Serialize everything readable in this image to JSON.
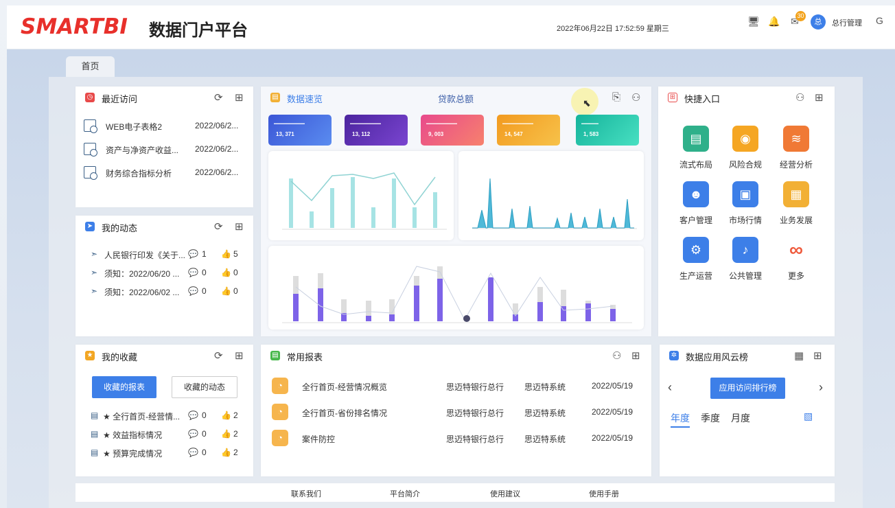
{
  "header": {
    "logo": "SMARTBI",
    "platform_name": "数据门户平台",
    "datetime": "2022年06月22日 17:52:59 星期三",
    "notification_badge": "30",
    "avatar_letter": "总",
    "username": "总行管理"
  },
  "tabs": [
    {
      "label": "首页"
    }
  ],
  "recent": {
    "title": "最近访问",
    "items": [
      {
        "name": "WEB电子表格2",
        "date": "2022/06/2..."
      },
      {
        "name": "资产与净资产收益...",
        "date": "2022/06/2..."
      },
      {
        "name": "财务综合指标分析",
        "date": "2022/06/2..."
      }
    ]
  },
  "dynamics": {
    "title": "我的动态",
    "items": [
      {
        "text": "人民银行印发《关于...",
        "comments": "1",
        "likes": "5"
      },
      {
        "text": "须知：2022/06/20 ...",
        "comments": "0",
        "likes": "0"
      },
      {
        "text": "须知：2022/06/02 ...",
        "comments": "0",
        "likes": "0"
      }
    ]
  },
  "favorites": {
    "title": "我的收藏",
    "btn_reports": "收藏的报表",
    "btn_dynamics": "收藏的动态",
    "items": [
      {
        "text": "★ 全行首页-经营情...",
        "comments": "0",
        "likes": "2"
      },
      {
        "text": "★ 效益指标情况",
        "comments": "0",
        "likes": "2"
      },
      {
        "text": "★ 预算完成情况",
        "comments": "0",
        "likes": "2"
      }
    ]
  },
  "data_overview": {
    "title": "数据速览",
    "subtitle": "贷款总额",
    "stats": [
      {
        "value": "13, 371",
        "color": "#4455d8"
      },
      {
        "value": "13, 112",
        "color": "#5d2fb0"
      },
      {
        "value": "9, 003",
        "color": "#ef5e8b"
      },
      {
        "value": "14, 547",
        "color": "#f4a623"
      },
      {
        "value": "1, 583",
        "color": "#26c3a6"
      }
    ]
  },
  "quick_entry": {
    "title": "快捷入口",
    "items": [
      {
        "label": "流式布局",
        "color": "#2fb08a",
        "icon": "▤"
      },
      {
        "label": "风险合规",
        "color": "#f5a623",
        "icon": "◉"
      },
      {
        "label": "经营分析",
        "color": "#f07935",
        "icon": "≋"
      },
      {
        "label": "客户管理",
        "color": "#3d7fe8",
        "icon": "☻"
      },
      {
        "label": "市场行情",
        "color": "#3d7fe8",
        "icon": "▣"
      },
      {
        "label": "业务发展",
        "color": "#f2b035",
        "icon": "▦"
      },
      {
        "label": "生产运营",
        "color": "#3d7fe8",
        "icon": "⚙"
      },
      {
        "label": "公共管理",
        "color": "#3d7fe8",
        "icon": "♪"
      },
      {
        "label": "更多",
        "color": "#ef5a3c",
        "icon": "∞"
      }
    ]
  },
  "common_reports": {
    "title": "常用报表",
    "rows": [
      {
        "name": "全行首页-经营情况概览",
        "org": "思迈特银行总行",
        "system": "思迈特系统",
        "date": "2022/05/19"
      },
      {
        "name": "全行首页-省份排名情况",
        "org": "思迈特银行总行",
        "system": "思迈特系统",
        "date": "2022/05/19"
      },
      {
        "name": "案件防控",
        "org": "思迈特银行总行",
        "system": "思迈特系统",
        "date": "2022/05/19"
      }
    ]
  },
  "ranking": {
    "title": "数据应用风云榜",
    "button": "应用访问排行榜",
    "periods": [
      "年度",
      "季度",
      "月度"
    ]
  },
  "footer": {
    "links": [
      "联系我们",
      "平台简介",
      "使用建议",
      "使用手册"
    ]
  }
}
